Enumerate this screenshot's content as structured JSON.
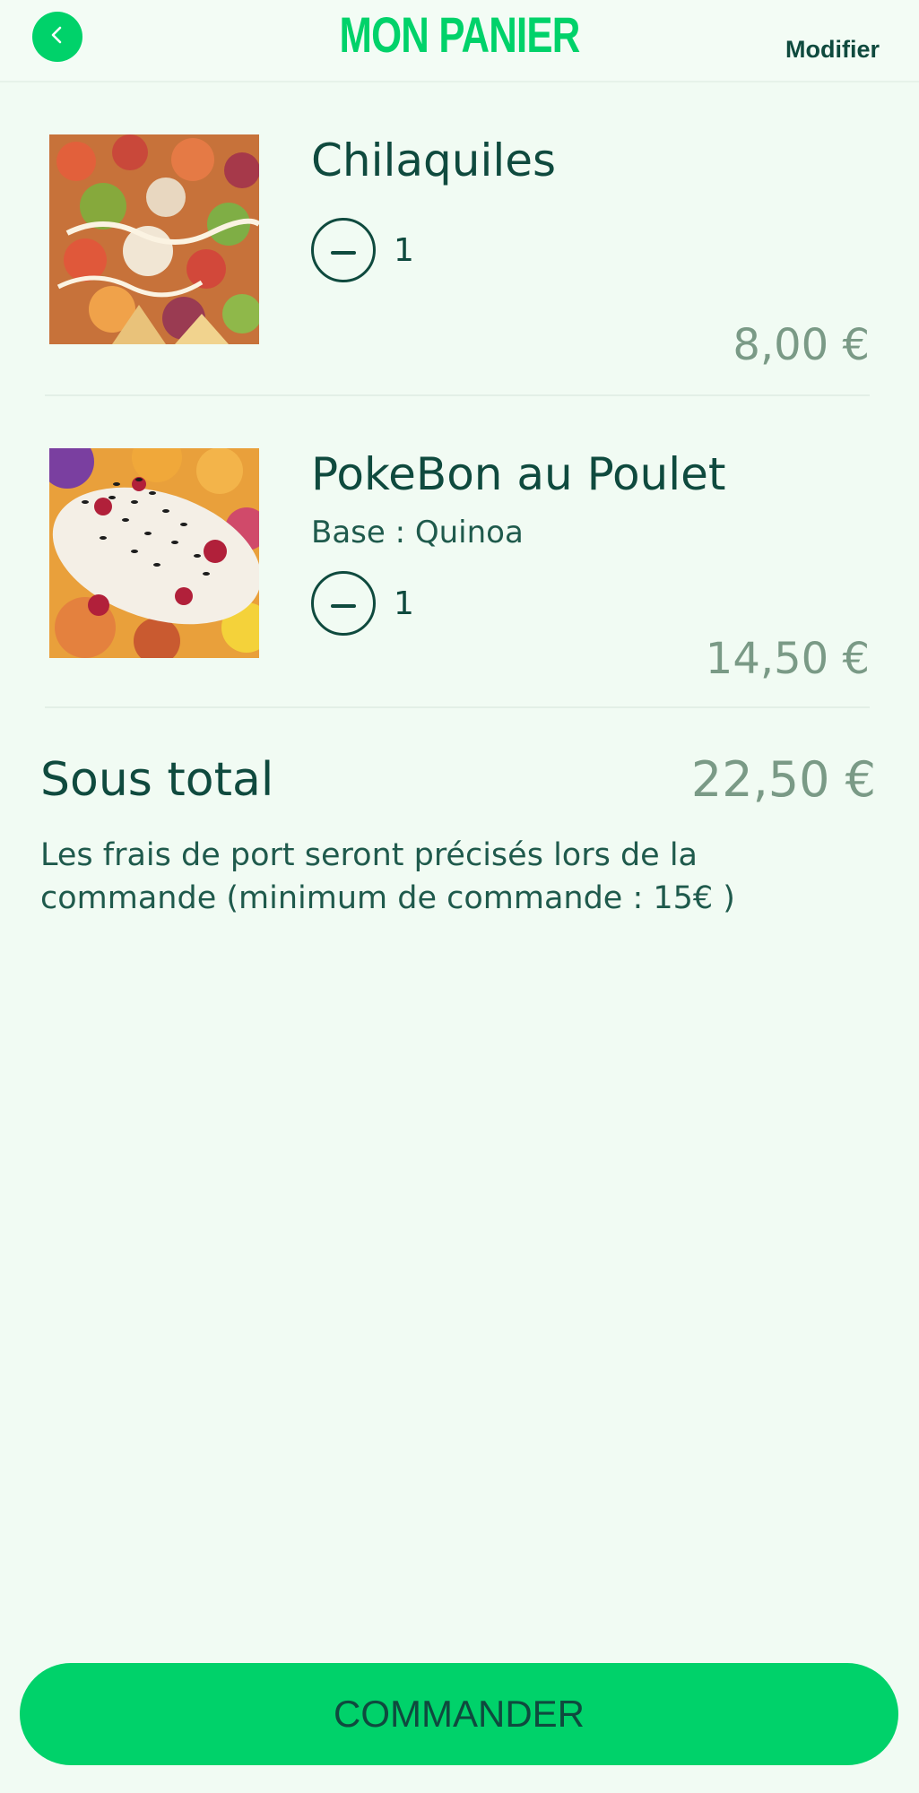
{
  "header": {
    "back_icon": "chevron-left-icon",
    "title": "MON PANIER",
    "edit_label": "Modifier"
  },
  "cart": {
    "items": [
      {
        "name": "Chilaquiles",
        "option": "",
        "quantity": "1",
        "price": "8,00 €",
        "decrement_icon": "minus-icon",
        "image": "chilaquiles-photo"
      },
      {
        "name": "PokeBon au Poulet",
        "option": "Base : Quinoa",
        "quantity": "1",
        "price": "14,50 €",
        "decrement_icon": "minus-icon",
        "image": "poke-bowl-photo"
      }
    ]
  },
  "summary": {
    "subtotal_label": "Sous total",
    "subtotal_value": "22,50 €",
    "shipping_note": "Les frais de port seront précisés lors de la commande (minimum de commande : 15€ )"
  },
  "footer": {
    "order_label": "COMMANDER"
  },
  "colors": {
    "accent": "#00d26a",
    "text_dark": "#0f4a3e",
    "price_muted": "#7a9a86",
    "background": "#f1fbf3"
  }
}
